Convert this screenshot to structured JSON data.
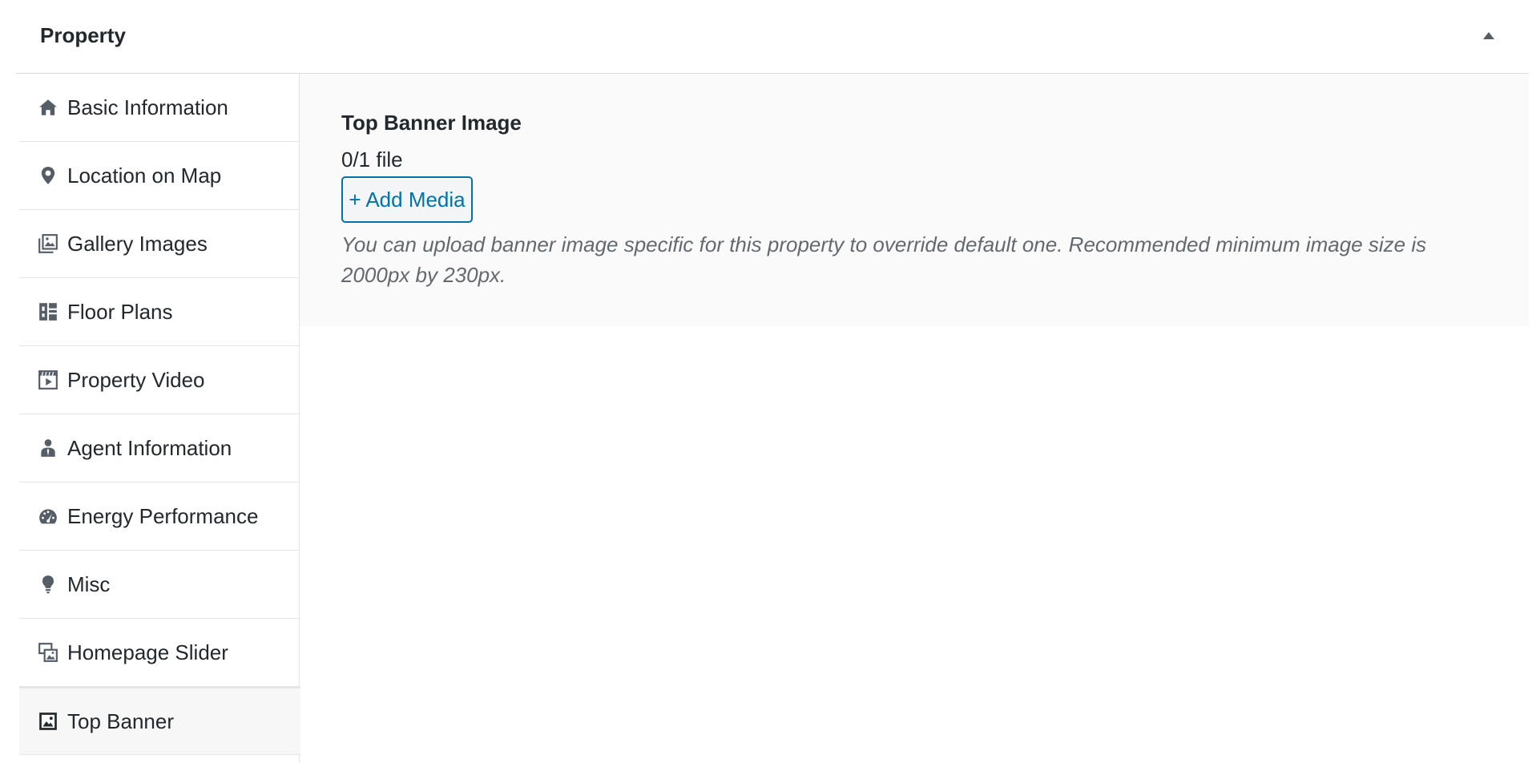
{
  "metabox": {
    "title": "Property"
  },
  "tabs": [
    {
      "label": "Basic Information",
      "icon": "home-icon"
    },
    {
      "label": "Location on Map",
      "icon": "location-pin-icon"
    },
    {
      "label": "Gallery Images",
      "icon": "gallery-icon"
    },
    {
      "label": "Floor Plans",
      "icon": "floor-plans-icon"
    },
    {
      "label": "Property Video",
      "icon": "video-icon"
    },
    {
      "label": "Agent Information",
      "icon": "agent-icon"
    },
    {
      "label": "Energy Performance",
      "icon": "dashboard-icon"
    },
    {
      "label": "Misc",
      "icon": "lightbulb-icon"
    },
    {
      "label": "Homepage Slider",
      "icon": "slides-icon"
    },
    {
      "label": "Top Banner",
      "icon": "format-image-icon",
      "active": true
    }
  ],
  "panel": {
    "field_label": "Top Banner Image",
    "file_count": "0/1 file",
    "add_media_label": "+ Add Media",
    "description": "You can upload banner image specific for this property to override default one. Recommended minimum image size is 2000px by 230px."
  },
  "colors": {
    "accent": "#0073aa",
    "text": "#23282d",
    "muted": "#646970",
    "icon": "#555d66",
    "panel_bg": "#fafafa"
  }
}
